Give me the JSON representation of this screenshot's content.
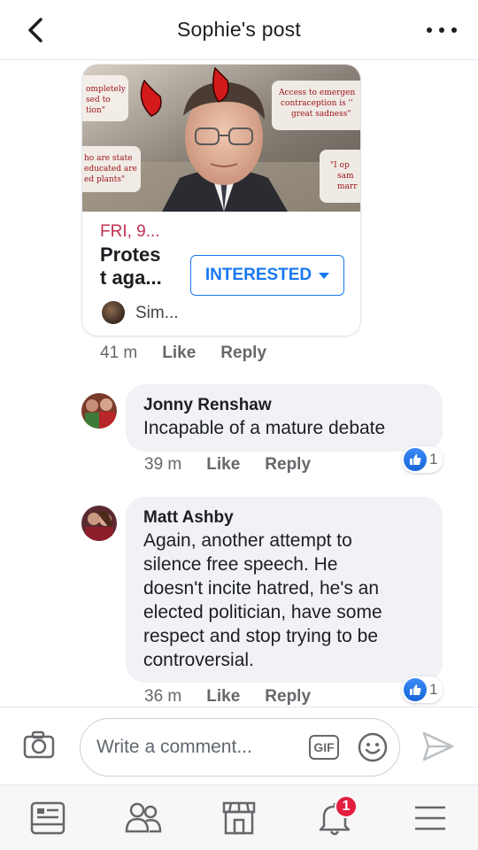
{
  "header": {
    "title": "Sophie's post"
  },
  "event_card": {
    "image_quotes": [
      "ompletely sed to tion\"",
      "Access to emergen contraception is '' great sadness\"",
      "ho are state educated are ed plants\"",
      "\"I op sam marr"
    ],
    "date": "FRI, 9...",
    "title_line1": "Protes",
    "title_line2": "t aga...",
    "interested_label": "INTERESTED",
    "host_name": "Sim..."
  },
  "post_meta": {
    "time": "41 m",
    "like": "Like",
    "reply": "Reply"
  },
  "comments": [
    {
      "author": "Jonny Renshaw",
      "lines": [
        "Incapable of a mature debate"
      ],
      "time": "39 m",
      "like": "Like",
      "reply": "Reply",
      "reaction_count": "1"
    },
    {
      "author": "Matt Ashby",
      "lines": [
        "Again, another attempt to",
        "silence free speech. He",
        "doesn't incite hatred, he's an",
        "elected politician, have some",
        "respect and stop trying to be",
        "controversial."
      ],
      "time": "36 m",
      "like": "Like",
      "reply": "Reply",
      "reaction_count": "1"
    }
  ],
  "composer": {
    "placeholder": "Write a comment...",
    "gif_label": "GIF"
  },
  "bottom_nav": {
    "notification_count": "1"
  },
  "colors": {
    "accent": "#1877f2",
    "date_red": "#c13050",
    "badge_red": "#e41e3f",
    "bubble_bg": "#f0f2f5"
  }
}
